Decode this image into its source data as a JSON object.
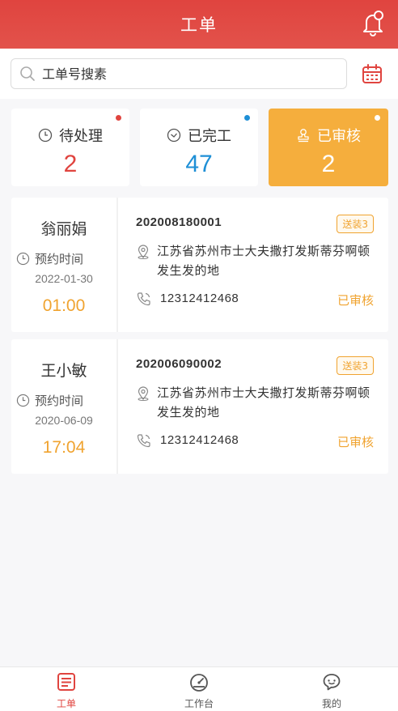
{
  "header": {
    "title": "工单"
  },
  "search": {
    "placeholder": "工单号搜素"
  },
  "stats": [
    {
      "label": "待处理",
      "value": "2",
      "color": "#e0443f",
      "dot": "#e0443f",
      "icon": "clock-icon"
    },
    {
      "label": "已完工",
      "value": "47",
      "color": "#1e8fd6",
      "dot": "#1e8fd6",
      "icon": "check-circle-icon"
    },
    {
      "label": "已审核",
      "value": "2",
      "color": "#ffffff",
      "dot": "#ffffff",
      "icon": "stamp-icon",
      "active": true
    }
  ],
  "orders": [
    {
      "name": "翁丽娟",
      "appt_label": "预约时间",
      "date": "2022-01-30",
      "time": "01:00",
      "order_no": "202008180001",
      "tag": "送装3",
      "address": "江苏省苏州市士大夫撒打发斯蒂芬啊顿发生发的地",
      "phone": "12312412468",
      "status": "已审核"
    },
    {
      "name": "王小敏",
      "appt_label": "预约时间",
      "date": "2020-06-09",
      "time": "17:04",
      "order_no": "202006090002",
      "tag": "送装3",
      "address": "江苏省苏州市士大夫撒打发斯蒂芬啊顿发生发的地",
      "phone": "12312412468",
      "status": "已审核"
    }
  ],
  "nav": [
    {
      "label": "工单",
      "icon": "work-order-icon",
      "active": true
    },
    {
      "label": "工作台",
      "icon": "dashboard-icon",
      "active": false
    },
    {
      "label": "我的",
      "icon": "profile-chat-icon",
      "active": false
    }
  ],
  "colors": {
    "brand": "#e0443f",
    "accent": "#f5ae3d",
    "info": "#1e8fd6"
  }
}
